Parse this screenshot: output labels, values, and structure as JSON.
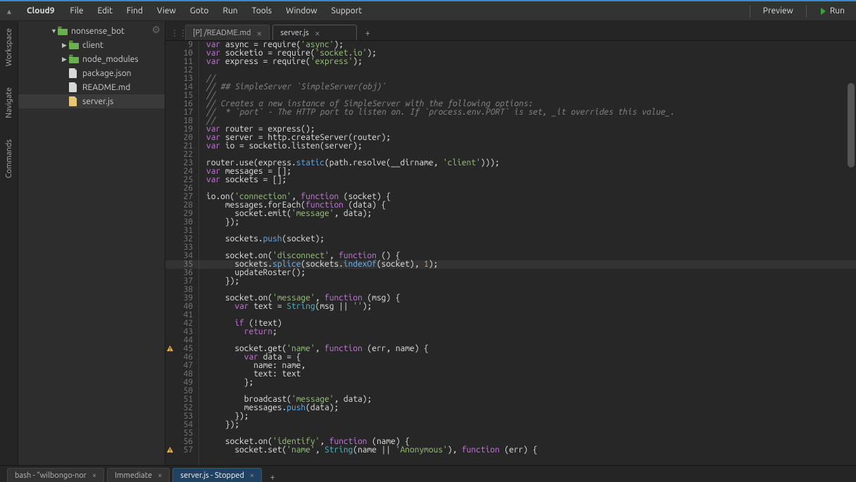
{
  "brand": "Cloud9",
  "menu": [
    "File",
    "Edit",
    "Find",
    "View",
    "Goto",
    "Run",
    "Tools",
    "Window",
    "Support"
  ],
  "actions": {
    "preview": "Preview",
    "run": "Run"
  },
  "left_tabs": [
    "Workspace",
    "Navigate",
    "Commands"
  ],
  "tree": {
    "root": {
      "name": "nonsense_bot",
      "open": true
    },
    "children": [
      {
        "type": "folder",
        "name": "client",
        "indent": 1
      },
      {
        "type": "folder",
        "name": "node_modules",
        "indent": 1
      },
      {
        "type": "file",
        "name": "package.json",
        "indent": 1,
        "ext": "json"
      },
      {
        "type": "file",
        "name": "README.md",
        "indent": 1,
        "ext": "md"
      },
      {
        "type": "file",
        "name": "server.js",
        "indent": 1,
        "ext": "js",
        "selected": true
      }
    ]
  },
  "editor_tabs": [
    {
      "label": "[P] /README.md",
      "active": false
    },
    {
      "label": "server.js",
      "active": true
    }
  ],
  "bottom_tabs": [
    {
      "label": "bash - \"wilbongo-nor",
      "active": false,
      "closable": true
    },
    {
      "label": "Immediate",
      "active": false,
      "closable": true
    },
    {
      "label": "server.js - Stopped",
      "active": true,
      "closable": true
    }
  ],
  "first_line_no": 9,
  "highlight_line": 35,
  "warnings": [
    45,
    57
  ],
  "code_lines": [
    [
      [
        "kw",
        "var"
      ],
      [
        "pl",
        " async = require("
      ],
      [
        "str",
        "'async'"
      ],
      [
        "pl",
        ");"
      ]
    ],
    [
      [
        "kw",
        "var"
      ],
      [
        "pl",
        " socketio = require("
      ],
      [
        "str",
        "'socket.io'"
      ],
      [
        "pl",
        ");"
      ]
    ],
    [
      [
        "kw",
        "var"
      ],
      [
        "pl",
        " express = require("
      ],
      [
        "str",
        "'express'"
      ],
      [
        "pl",
        ");"
      ]
    ],
    [],
    [
      [
        "cmt",
        "//"
      ]
    ],
    [
      [
        "cmt",
        "// ## SimpleServer `SimpleServer(obj)`"
      ]
    ],
    [
      [
        "cmt",
        "//"
      ]
    ],
    [
      [
        "cmt",
        "// Creates a new instance of SimpleServer with the following options:"
      ]
    ],
    [
      [
        "cmt",
        "//  * `port` - The HTTP port to listen on. If `process.env.PORT` is set, _it overrides this value_."
      ]
    ],
    [
      [
        "cmt",
        "//"
      ]
    ],
    [
      [
        "kw",
        "var"
      ],
      [
        "pl",
        " router = express();"
      ]
    ],
    [
      [
        "kw",
        "var"
      ],
      [
        "pl",
        " server = http.createServer(router);"
      ]
    ],
    [
      [
        "kw",
        "var"
      ],
      [
        "pl",
        " io = socketio.listen(server);"
      ]
    ],
    [],
    [
      [
        "pl",
        "router.use(express."
      ],
      [
        "method",
        "static"
      ],
      [
        "pl",
        "(path.resolve(__dirname, "
      ],
      [
        "str",
        "'client'"
      ],
      [
        "pl",
        ")));"
      ]
    ],
    [
      [
        "kw",
        "var"
      ],
      [
        "pl",
        " messages = [];"
      ]
    ],
    [
      [
        "kw",
        "var"
      ],
      [
        "pl",
        " sockets = [];"
      ]
    ],
    [],
    [
      [
        "pl",
        "io.on("
      ],
      [
        "str",
        "'connection'"
      ],
      [
        "pl",
        ", "
      ],
      [
        "func",
        "function"
      ],
      [
        "pl",
        " (socket) {"
      ]
    ],
    [
      [
        "pl",
        "    messages.forEach("
      ],
      [
        "func",
        "function"
      ],
      [
        "pl",
        " (data) {"
      ]
    ],
    [
      [
        "pl",
        "      socket.emit("
      ],
      [
        "str",
        "'message'"
      ],
      [
        "pl",
        ", data);"
      ]
    ],
    [
      [
        "pl",
        "    });"
      ]
    ],
    [],
    [
      [
        "pl",
        "    sockets."
      ],
      [
        "method",
        "push"
      ],
      [
        "pl",
        "(socket);"
      ]
    ],
    [],
    [
      [
        "pl",
        "    socket.on("
      ],
      [
        "str",
        "'disconnect'"
      ],
      [
        "pl",
        ", "
      ],
      [
        "func",
        "function"
      ],
      [
        "pl",
        " () {"
      ]
    ],
    [
      [
        "pl",
        "      sockets."
      ],
      [
        "method",
        "splice"
      ],
      [
        "pl",
        "(sockets."
      ],
      [
        "method",
        "indexOf"
      ],
      [
        "pl",
        "(socket), "
      ],
      [
        "num",
        "1"
      ],
      [
        "pl",
        ");"
      ]
    ],
    [
      [
        "pl",
        "      updateRoster();"
      ]
    ],
    [
      [
        "pl",
        "    });"
      ]
    ],
    [],
    [
      [
        "pl",
        "    socket.on("
      ],
      [
        "str",
        "'message'"
      ],
      [
        "pl",
        ", "
      ],
      [
        "func",
        "function"
      ],
      [
        "pl",
        " (msg) {"
      ]
    ],
    [
      [
        "pl",
        "      "
      ],
      [
        "kw",
        "var"
      ],
      [
        "pl",
        " text = "
      ],
      [
        "lib",
        "String"
      ],
      [
        "pl",
        "(msg || "
      ],
      [
        "str",
        "''"
      ],
      [
        "pl",
        ");"
      ]
    ],
    [],
    [
      [
        "pl",
        "      "
      ],
      [
        "kw",
        "if"
      ],
      [
        "pl",
        " (!text)"
      ]
    ],
    [
      [
        "pl",
        "        "
      ],
      [
        "kw",
        "return"
      ],
      [
        "pl",
        ";"
      ]
    ],
    [],
    [
      [
        "pl",
        "      socket.get("
      ],
      [
        "str",
        "'name'"
      ],
      [
        "pl",
        ", "
      ],
      [
        "func",
        "function"
      ],
      [
        "pl",
        " (err, name) {"
      ]
    ],
    [
      [
        "pl",
        "        "
      ],
      [
        "kw",
        "var"
      ],
      [
        "pl",
        " data = {"
      ]
    ],
    [
      [
        "pl",
        "          name: name,"
      ]
    ],
    [
      [
        "pl",
        "          text: text"
      ]
    ],
    [
      [
        "pl",
        "        };"
      ]
    ],
    [],
    [
      [
        "pl",
        "        broadcast("
      ],
      [
        "str",
        "'message'"
      ],
      [
        "pl",
        ", data);"
      ]
    ],
    [
      [
        "pl",
        "        messages."
      ],
      [
        "method",
        "push"
      ],
      [
        "pl",
        "(data);"
      ]
    ],
    [
      [
        "pl",
        "      });"
      ]
    ],
    [
      [
        "pl",
        "    });"
      ]
    ],
    [],
    [
      [
        "pl",
        "    socket.on("
      ],
      [
        "str",
        "'identify'"
      ],
      [
        "pl",
        ", "
      ],
      [
        "func",
        "function"
      ],
      [
        "pl",
        " (name) {"
      ]
    ],
    [
      [
        "pl",
        "      socket.set("
      ],
      [
        "str",
        "'name'"
      ],
      [
        "pl",
        ", "
      ],
      [
        "lib",
        "String"
      ],
      [
        "pl",
        "(name || "
      ],
      [
        "str",
        "'Anonymous'"
      ],
      [
        "pl",
        "), "
      ],
      [
        "func",
        "function"
      ],
      [
        "pl",
        " (err) {"
      ]
    ]
  ]
}
